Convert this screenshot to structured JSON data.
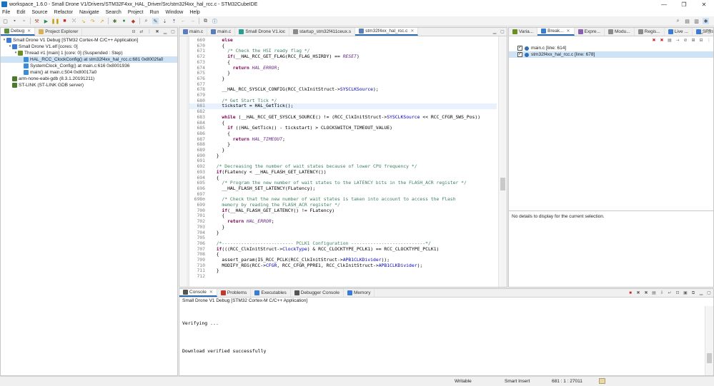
{
  "window": {
    "title": "workspace_1.6.0 - Small Drone V1/Drivers/STM32F4xx_HAL_Driver/Src/stm32f4xx_hal_rcc.c - STM32CubeIDE",
    "minimize": "—",
    "maximize": "❐",
    "close": "✕"
  },
  "menu": [
    "File",
    "Edit",
    "Source",
    "Refactor",
    "Navigate",
    "Search",
    "Project",
    "Run",
    "Window",
    "Help"
  ],
  "debug_panel": {
    "tabs": [
      {
        "label": "Debug",
        "close": "✕"
      },
      {
        "label": "Project Explorer"
      }
    ],
    "tree": [
      {
        "label": "Small Drone V1 Debug [STM32 Cortex-M C/C++ Application]",
        "level": 0,
        "twisty": "▾"
      },
      {
        "label": "Small Drone V1.elf [cores: 0]",
        "level": 1,
        "twisty": "▾"
      },
      {
        "label": "Thread #1 [main] 1 [core: 0] (Suspended : Step)",
        "level": 2,
        "twisty": "▾"
      },
      {
        "label": "HAL_RCC_ClockConfig() at stm32f4xx_hal_rcc.c:681 0x8002fa0",
        "level": 3,
        "twisty": "",
        "selected": true
      },
      {
        "label": "SystemClock_Config() at main.c:616 0x8001936",
        "level": 3,
        "twisty": ""
      },
      {
        "label": "main() at main.c:504 0x80017a0",
        "level": 3,
        "twisty": ""
      },
      {
        "label": "arm-none-eabi-gdb (8.3.1.20191211)",
        "level": 1,
        "twisty": ""
      },
      {
        "label": "ST-LINK (ST-LINK GDB server)",
        "level": 1,
        "twisty": ""
      }
    ]
  },
  "editor": {
    "tabs": [
      {
        "label": "main.c"
      },
      {
        "label": "main.c"
      },
      {
        "label": "Small Drone V1.ioc"
      },
      {
        "label": "startup_stm32f411ceux.s"
      },
      {
        "label": "stm32f4xx_hal_rcc.c",
        "close": "✕",
        "active": true
      }
    ],
    "lines": [
      {
        "n": "669",
        "html": "    <span class=\"kw\">else</span>"
      },
      {
        "n": "670",
        "html": "    {"
      },
      {
        "n": "671",
        "html": "      <span class=\"cm\">/* Check the HSI ready flag */</span>"
      },
      {
        "n": "672",
        "html": "      <span class=\"kw\">if</span>(__HAL_RCC_GET_FLAG(RCC_FLAG_HSIRDY) == <span class=\"it\">RESET</span>)"
      },
      {
        "n": "673",
        "html": "      {"
      },
      {
        "n": "674",
        "html": "        <span class=\"kw\">return</span> <span class=\"it\">HAL_ERROR</span>;"
      },
      {
        "n": "675",
        "html": "      }"
      },
      {
        "n": "676",
        "html": "    }"
      },
      {
        "n": "677",
        "html": ""
      },
      {
        "n": "678",
        "html": "    __HAL_RCC_SYSCLK_CONFIG(RCC_ClkInitStruct-><span class=\"fd\">SYSCLKSource</span>);"
      },
      {
        "n": "679",
        "html": ""
      },
      {
        "n": "680",
        "html": "    <span class=\"cm\">/* Get Start Tick */</span>"
      },
      {
        "n": "681",
        "html": "    tickstart = HAL_GetTick();",
        "current": true
      },
      {
        "n": "682",
        "html": ""
      },
      {
        "n": "683",
        "html": "    <span class=\"kw\">while</span> (__HAL_RCC_GET_SYSCLK_SOURCE() != (RCC_ClkInitStruct-><span class=\"fd\">SYSCLKSource</span> &lt;&lt; RCC_CFGR_SWS_Pos))"
      },
      {
        "n": "684",
        "html": "    {"
      },
      {
        "n": "685",
        "html": "      <span class=\"kw\">if</span> ((HAL_GetTick() - tickstart) > CLOCKSWITCH_TIMEOUT_VALUE)"
      },
      {
        "n": "686",
        "html": "      {"
      },
      {
        "n": "687",
        "html": "        <span class=\"kw\">return</span> <span class=\"it\">HAL_TIMEOUT</span>;"
      },
      {
        "n": "688",
        "html": "      }"
      },
      {
        "n": "689",
        "html": "    }"
      },
      {
        "n": "690",
        "html": "  }"
      },
      {
        "n": "691",
        "html": ""
      },
      {
        "n": "692",
        "html": "  <span class=\"cm\">/* Decreasing the number of wait states because of lower CPU frequency */</span>"
      },
      {
        "n": "693",
        "html": "  <span class=\"kw\">if</span>(FLatency &lt; __HAL_FLASH_GET_LATENCY())"
      },
      {
        "n": "694",
        "html": "  {"
      },
      {
        "n": "695",
        "html": "    <span class=\"cm\">/* Program the new number of wait states to the LATENCY bits in the FLASH_ACR register */</span>"
      },
      {
        "n": "696",
        "html": "    __HAL_FLASH_SET_LATENCY(FLatency);"
      },
      {
        "n": "697",
        "html": ""
      },
      {
        "n": "698⊖",
        "html": "    <span class=\"cm\">/* Check that the new number of wait states is taken into account to access the Flash</span>"
      },
      {
        "n": "699",
        "html": "    <span class=\"cm\">memory by reading the FLASH_ACR register */</span>"
      },
      {
        "n": "700",
        "html": "    <span class=\"kw\">if</span>(__HAL_FLASH_GET_LATENCY() != FLatency)"
      },
      {
        "n": "701",
        "html": "    {"
      },
      {
        "n": "702",
        "html": "      <span class=\"kw\">return</span> <span class=\"it\">HAL_ERROR</span>;"
      },
      {
        "n": "703",
        "html": "    }"
      },
      {
        "n": "704",
        "html": "  }"
      },
      {
        "n": "705",
        "html": ""
      },
      {
        "n": "706",
        "html": "  <span class=\"cm\">/*-------------------------- PCLK1 Configuration ---------------------------*/</span>"
      },
      {
        "n": "707",
        "html": "  <span class=\"kw\">if</span>(((RCC_ClkInitStruct-><span class=\"fd\">ClockType</span>) &amp; RCC_CLOCKTYPE_PCLK1) == RCC_CLOCKTYPE_PCLK1)"
      },
      {
        "n": "708",
        "html": "  {"
      },
      {
        "n": "709",
        "html": "    assert_param(IS_RCC_PCLK(RCC_ClkInitStruct-><span class=\"fd\">APB1CLKDivider</span>));"
      },
      {
        "n": "710",
        "html": "    MODIFY_REG(RCC-><span class=\"fd\">CFGR</span>, RCC_CFGR_PPRE1, RCC_ClkInitStruct-><span class=\"fd\">APB1CLKDivider</span>);"
      },
      {
        "n": "711",
        "html": "  }"
      },
      {
        "n": "712",
        "html": ""
      }
    ]
  },
  "breakpoints_panel": {
    "tabs": [
      {
        "label": "Varia..."
      },
      {
        "label": "Break...",
        "close": "✕",
        "active": true
      },
      {
        "label": "Expre..."
      },
      {
        "label": "Modu..."
      },
      {
        "label": "Regis..."
      },
      {
        "label": "Live ..."
      },
      {
        "label": "SFRs"
      }
    ],
    "items": [
      {
        "label": "main.c [line: 614]",
        "checked": "✓"
      },
      {
        "label": "stm32f4xx_hal_rcc.c [line: 678]",
        "checked": "✓",
        "selected": true
      }
    ],
    "details": "No details to display for the current selection."
  },
  "console": {
    "tabs": [
      {
        "label": "Console",
        "close": "✕",
        "active": true
      },
      {
        "label": "Problems"
      },
      {
        "label": "Executables"
      },
      {
        "label": "Debugger Console"
      },
      {
        "label": "Memory"
      }
    ],
    "subtitle": "Small Drone V1 Debug [STM32 Cortex-M C/C++ Application]",
    "lines": [
      "Verifying ...",
      "Download verified successfully"
    ]
  },
  "status": {
    "writable": "Writable",
    "insert": "Smart Insert",
    "position": "681 : 1 : 27011"
  }
}
